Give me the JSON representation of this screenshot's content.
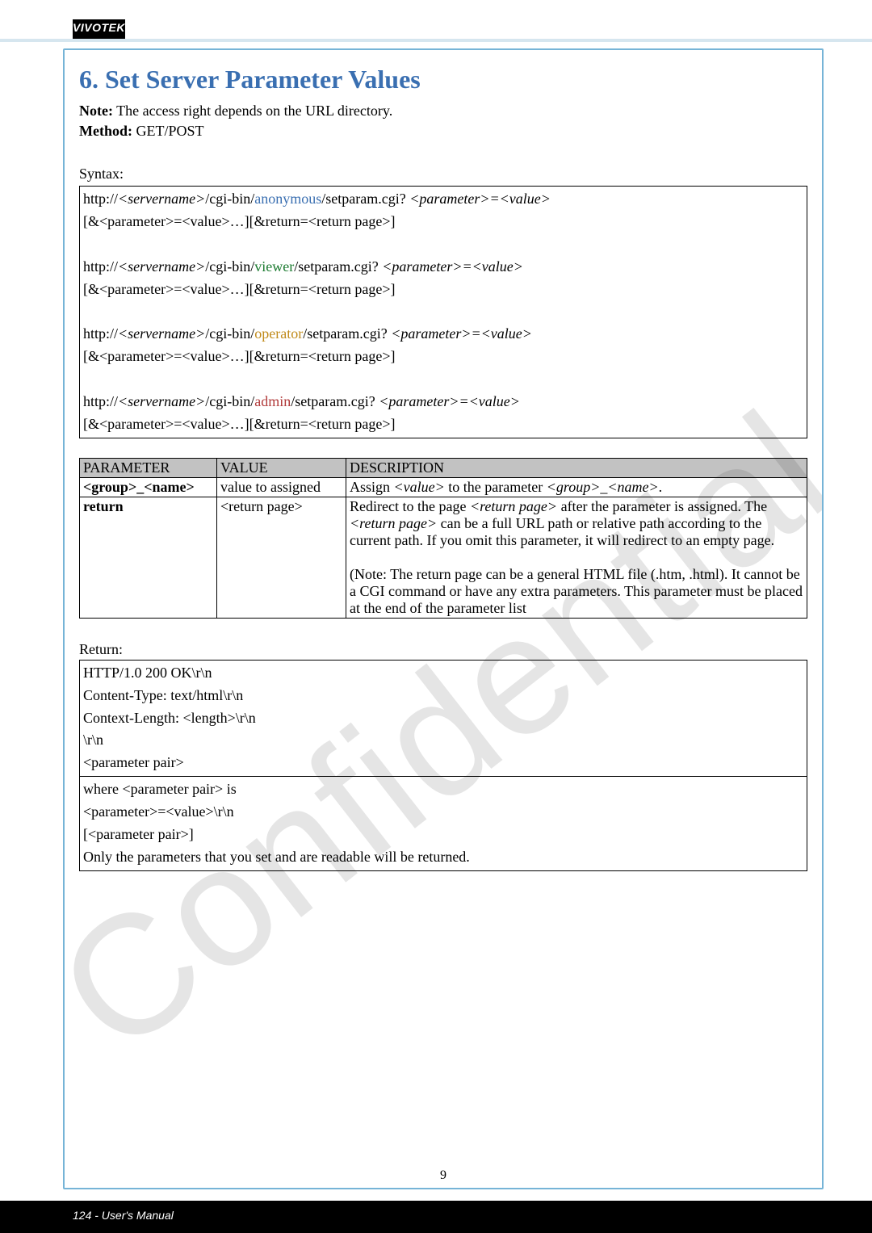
{
  "brand": "VIVOTEK",
  "watermark": "Confidential",
  "heading": "6. Set Server Parameter Values",
  "note_label": "Note:",
  "note_text": " The access right depends on the URL directory.",
  "method_label": "Method:",
  "method_text": " GET/POST",
  "syntax_label": "Syntax:",
  "syntax": {
    "anon": {
      "p1a": "http://",
      "srv": "<servername>",
      "p1b": "/cgi-bin/",
      "role": "anonymous",
      "p1c": "/setparam.cgi? ",
      "kv": "<parameter>=<value>",
      "l2": "[&<parameter>=<value>…][&return=<return page>]"
    },
    "viewer": {
      "p1a": "http://",
      "srv": "<servername>",
      "p1b": "/cgi-bin/",
      "role": "viewer",
      "p1c": "/setparam.cgi? ",
      "kv": "<parameter>=<value>",
      "l2": "[&<parameter>=<value>…][&return=<return page>]"
    },
    "operator": {
      "p1a": "http://",
      "srv": "<servername>",
      "p1b": "/cgi-bin/",
      "role": "operator",
      "p1c": "/setparam.cgi? ",
      "kv": "<parameter>=<value>",
      "l2": "[&<parameter>=<value>…][&return=<return page>]"
    },
    "admin": {
      "p1a": "http://",
      "srv": "<servername>",
      "p1b": "/cgi-bin/",
      "role": "admin",
      "p1c": "/setparam.cgi? ",
      "kv": "<parameter>=<value>",
      "l2": "[&<parameter>=<value>…][&return=<return page>]"
    }
  },
  "table": {
    "h1": "PARAMETER",
    "h2": "VALUE",
    "h3": "DESCRIPTION",
    "r1": {
      "param": "<group>_<name>",
      "value": "value to assigned",
      "d_a": "Assign ",
      "d_val": "<value>",
      "d_b": " to the parameter ",
      "d_grp": "<group>_<name>",
      "d_c": "."
    },
    "r2": {
      "param": "return",
      "value": "<return page>",
      "d_a": "Redirect to the page ",
      "d_rp1": "<return page>",
      "d_b": " after the parameter is assigned. The ",
      "d_rp2": "<return page>",
      "d_c": " can be a full URL path or relative path according to the current path. If you omit this parameter, it will redirect to an empty page.",
      "note": "(Note: The return page can be a general HTML file (.htm, .html). It cannot be a CGI command or have any extra parameters. This parameter must be placed at the end of the parameter list"
    }
  },
  "return_label": "Return:",
  "return_box1": {
    "l1": "HTTP/1.0 200 OK\\r\\n",
    "l2": "Content-Type: text/html\\r\\n",
    "l3": "Context-Length: <length>\\r\\n",
    "l4": "\\r\\n",
    "l5": "<parameter pair>"
  },
  "return_box2": {
    "l1": "where <parameter pair> is",
    "l2": "<parameter>=<value>\\r\\n",
    "l3": "[<parameter pair>]",
    "l4": "Only the parameters that you set and are readable will be returned."
  },
  "footer_left": "124 - User's Manual",
  "inner_pageno": "9"
}
